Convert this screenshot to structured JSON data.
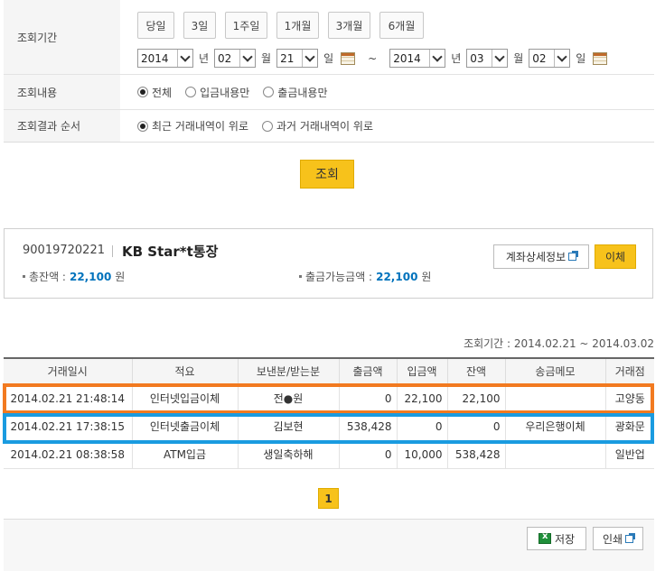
{
  "search": {
    "period_label": "조회기간",
    "content_label": "조회내용",
    "order_label": "조회결과 순서",
    "quick_buttons": [
      "당일",
      "3일",
      "1주일",
      "1개월",
      "3개월",
      "6개월"
    ],
    "from": {
      "year": "2014",
      "month": "02",
      "day": "21"
    },
    "to": {
      "year": "2014",
      "month": "03",
      "day": "02"
    },
    "unit_year": "년",
    "unit_month": "월",
    "unit_day": "일",
    "tilde": "~",
    "content_options": [
      "전체",
      "입금내용만",
      "출금내용만"
    ],
    "content_selected": 0,
    "order_options": [
      "최근 거래내역이 위로",
      "과거 거래내역이 위로"
    ],
    "order_selected": 0,
    "search_button": "조회"
  },
  "account": {
    "number": "90019720221",
    "name": "KB Star*t통장",
    "balance_label": "총잔액 :",
    "balance_value": "22,100",
    "balance_unit": "원",
    "available_label": "출금가능금액 :",
    "available_value": "22,100",
    "available_unit": "원",
    "detail_button": "계좌상세정보",
    "transfer_button": "이체"
  },
  "results": {
    "period_text": "조회기간 : 2014.02.21 ~ 2014.03.02",
    "columns": [
      "거래일시",
      "적요",
      "보낸분/받는분",
      "출금액",
      "입금액",
      "잔액",
      "송금메모",
      "거래점"
    ],
    "rows": [
      [
        "2014.02.21 21:48:14",
        "인터넷입금이체",
        "전●원",
        "0",
        "22,100",
        "22,100",
        "",
        "고양동"
      ],
      [
        "2014.02.21 17:38:15",
        "인터넷출금이체",
        "김보현",
        "538,428",
        "0",
        "0",
        "우리은행이체",
        "광화문"
      ],
      [
        "2014.02.21 08:38:58",
        "ATM입금",
        "생일축하해",
        "0",
        "10,000",
        "538,428",
        "",
        "일반업"
      ]
    ],
    "page": "1",
    "save_button": "저장",
    "print_button": "인쇄"
  },
  "colors": {
    "accent": "#f7c21b",
    "highlight_orange": "#f27a20",
    "highlight_blue": "#1a9be0",
    "amount": "#0072bc"
  }
}
